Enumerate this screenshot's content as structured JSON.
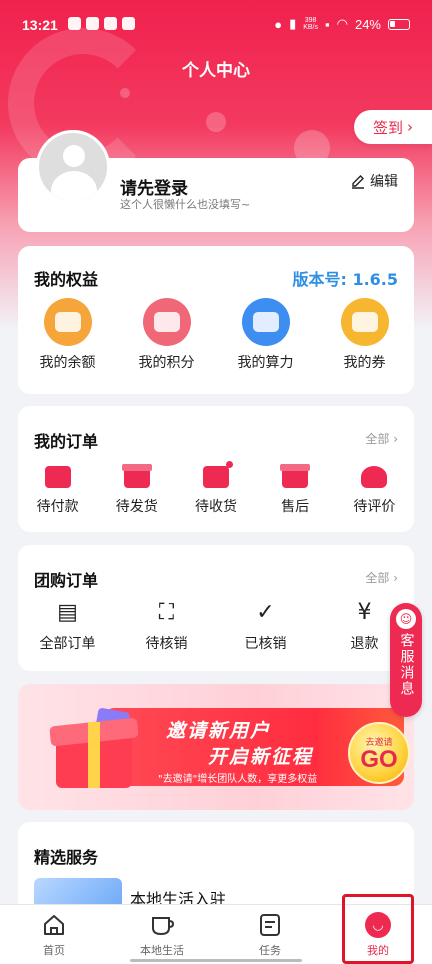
{
  "status_bar": {
    "time": "13:21",
    "net_speed_top": "398",
    "net_speed_bottom": "KB/s",
    "battery": "24%"
  },
  "header": {
    "title": "个人中心",
    "sign_in": "签到"
  },
  "profile": {
    "login_prompt": "请先登录",
    "motto": "这个人很懒什么也没填写~",
    "edit_label": "编辑"
  },
  "benefits": {
    "title": "我的权益",
    "version": "版本号: 1.6.5",
    "items": [
      {
        "label": "我的余额",
        "color": "#f5a53a"
      },
      {
        "label": "我的积分",
        "color": "#f06878"
      },
      {
        "label": "我的算力",
        "color": "#3d8ef0"
      },
      {
        "label": "我的券",
        "color": "#f6b630"
      }
    ]
  },
  "orders": {
    "title": "我的订单",
    "more": "全部",
    "items": [
      {
        "label": "待付款"
      },
      {
        "label": "待发货"
      },
      {
        "label": "待收货"
      },
      {
        "label": "售后"
      },
      {
        "label": "待评价"
      }
    ]
  },
  "group_orders": {
    "title": "团购订单",
    "more": "全部",
    "items": [
      {
        "label": "全部订单"
      },
      {
        "label": "待核销"
      },
      {
        "label": "已核销"
      },
      {
        "label": "退款"
      }
    ]
  },
  "banner": {
    "line1": "邀请新用户",
    "line2": "开启新征程",
    "sub": "\"去邀请\"增长团队人数，享更多权益",
    "go_small": "去邀请",
    "go_big": "GO"
  },
  "services": {
    "title": "精选服务",
    "item_label": "本地生活入驻"
  },
  "customer_service": {
    "label": "客服消息"
  },
  "tabbar": {
    "tabs": [
      {
        "label": "首页"
      },
      {
        "label": "本地生活"
      },
      {
        "label": "任务"
      },
      {
        "label": "我的"
      }
    ]
  },
  "colors": {
    "accent": "#ef2a52",
    "version_blue": "#2f8fe4"
  }
}
